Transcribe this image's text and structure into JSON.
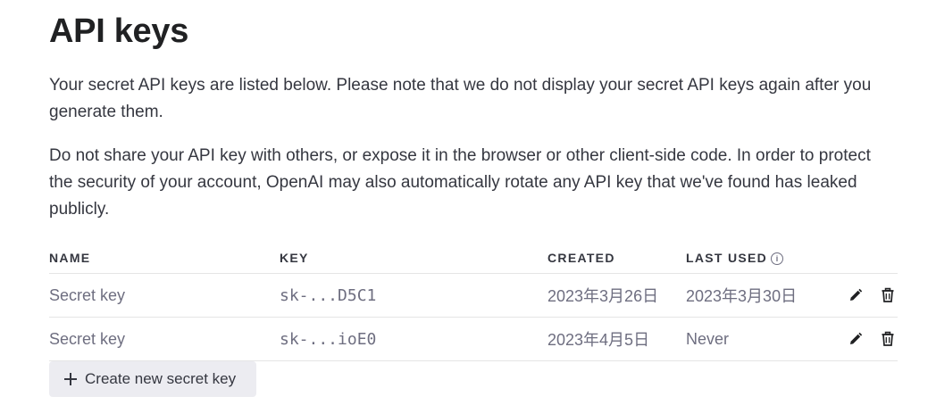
{
  "page": {
    "title": "API keys",
    "intro": "Your secret API keys are listed below. Please note that we do not display your secret API keys again after you generate them.",
    "warning": "Do not share your API key with others, or expose it in the browser or other client-side code. In order to protect the security of your account, OpenAI may also automatically rotate any API key that we've found has leaked publicly."
  },
  "table": {
    "headers": {
      "name": "NAME",
      "key": "KEY",
      "created": "CREATED",
      "last_used": "LAST USED",
      "last_used_info_icon": "info-icon"
    },
    "rows": [
      {
        "name": "Secret key",
        "key": "sk-...D5C1",
        "created": "2023年3月26日",
        "last_used": "2023年3月30日",
        "edit_icon": "pencil-icon",
        "delete_icon": "trash-icon"
      },
      {
        "name": "Secret key",
        "key": "sk-...ioE0",
        "created": "2023年4月5日",
        "last_used": "Never",
        "edit_icon": "pencil-icon",
        "delete_icon": "trash-icon"
      }
    ]
  },
  "actions": {
    "create_label": "Create new secret key",
    "create_icon": "plus-icon"
  },
  "colors": {
    "text_primary": "#202123",
    "text_body": "#353740",
    "text_muted": "#6e6e80",
    "button_bg": "#ececf1",
    "divider": "#e5e5e5"
  }
}
